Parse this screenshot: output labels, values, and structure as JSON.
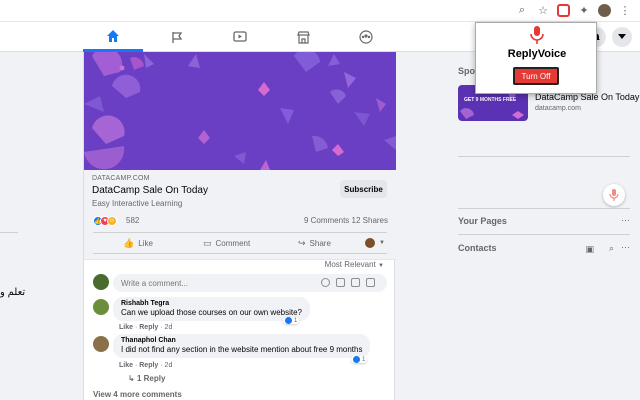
{
  "left": {
    "text": "تعلم و"
  },
  "post": {
    "link": {
      "domain": "DATACAMP.COM",
      "title": "DataCamp Sale On Today",
      "subtitle": "Easy Interactive Learning",
      "subscribe_label": "Subscribe"
    },
    "reactions": {
      "count": "582",
      "comments": "9 Comments",
      "shares": "12 Shares"
    },
    "actions": {
      "like": "Like",
      "comment": "Comment",
      "share": "Share"
    },
    "sort_label": "Most Relevant",
    "comment_placeholder": "Write a comment...",
    "comments": [
      {
        "name": "Rishabh Tegra",
        "text": "Can we upload those courses on our own website?",
        "like": "Like",
        "reply": "Reply",
        "time": "2d",
        "reactions": "1"
      },
      {
        "name": "Thanaphol Chan",
        "text": "I did not find any section in the website mention about free 9 months",
        "like": "Like",
        "reply": "Reply",
        "time": "2d",
        "reactions": "1",
        "replies": "1 Reply"
      }
    ],
    "view_more": "View 4 more comments"
  },
  "right": {
    "sponsored_label": "Spo",
    "ad_badge": "GET 9 MONTHS FREE",
    "ad_title": "DataCamp Sale On Today",
    "ad_domain": "datacamp.com",
    "your_pages": "Your Pages",
    "contacts": "Contacts"
  },
  "popup": {
    "title": "ReplyVoice",
    "button": "Turn Off"
  },
  "colors": {
    "accent": "#1877f2",
    "banner": "#6a3fc4",
    "popup_button": "#e53935"
  }
}
